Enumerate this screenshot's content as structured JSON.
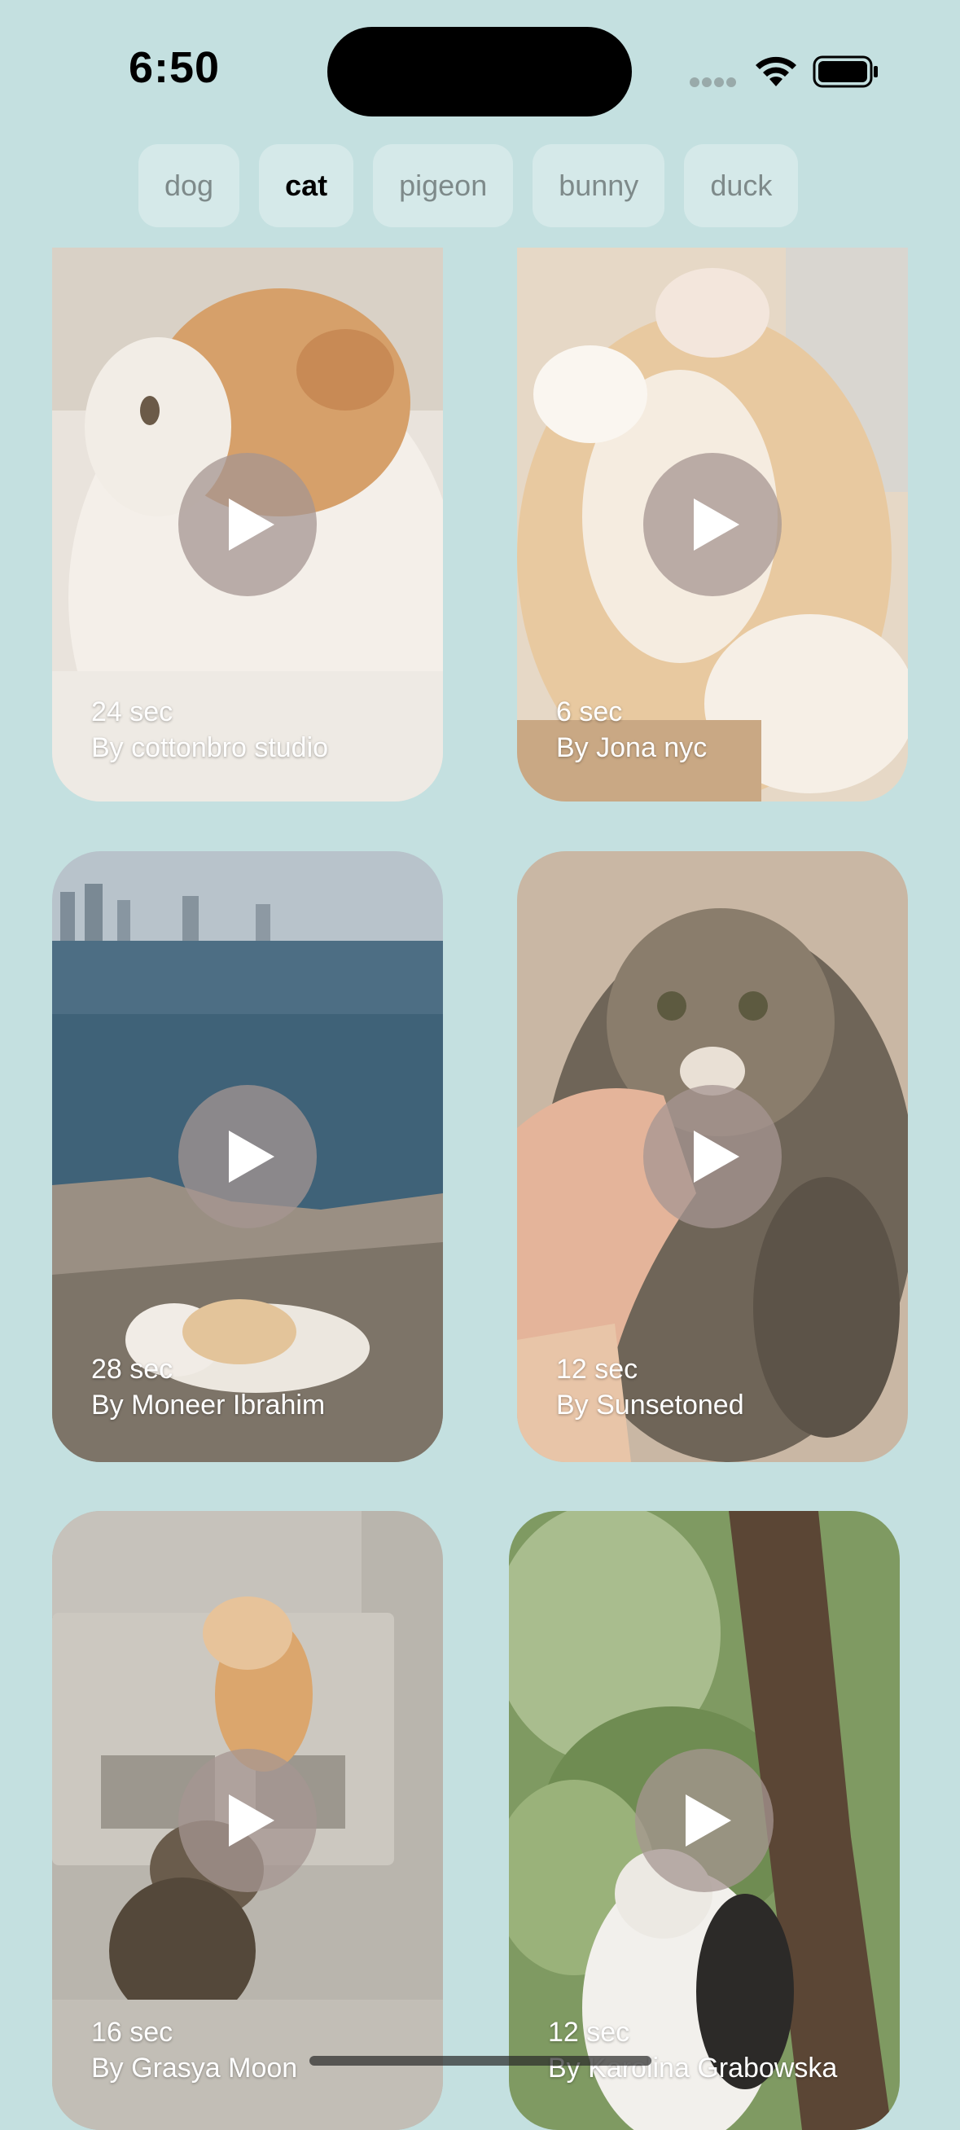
{
  "status_bar": {
    "time": "6:50"
  },
  "filters": [
    {
      "label": "dog",
      "selected": false
    },
    {
      "label": "cat",
      "selected": true
    },
    {
      "label": "pigeon",
      "selected": false
    },
    {
      "label": "bunny",
      "selected": false
    },
    {
      "label": "duck",
      "selected": false
    }
  ],
  "videos": [
    {
      "duration": "24 sec",
      "author": "By cottonbro studio",
      "thumbnail": "orange-white-cat"
    },
    {
      "duration": "6 sec",
      "author": "By Jona nyc",
      "thumbnail": "cat-lying-on-back"
    },
    {
      "duration": "28 sec",
      "author": "By Moneer  Ibrahim",
      "thumbnail": "cat-on-rocks-by-sea"
    },
    {
      "duration": "12 sec",
      "author": "By Sunsetoned",
      "thumbnail": "tabby-kitten-with-hand"
    },
    {
      "duration": "16 sec",
      "author": "By Grasya Moon",
      "thumbnail": "kittens-on-cinder-block"
    },
    {
      "duration": "12 sec",
      "author": "By Karolina Grabowska",
      "thumbnail": "cat-by-tree"
    }
  ],
  "icons": {
    "play": "play-icon",
    "wifi": "wifi-icon",
    "battery": "battery-icon"
  }
}
